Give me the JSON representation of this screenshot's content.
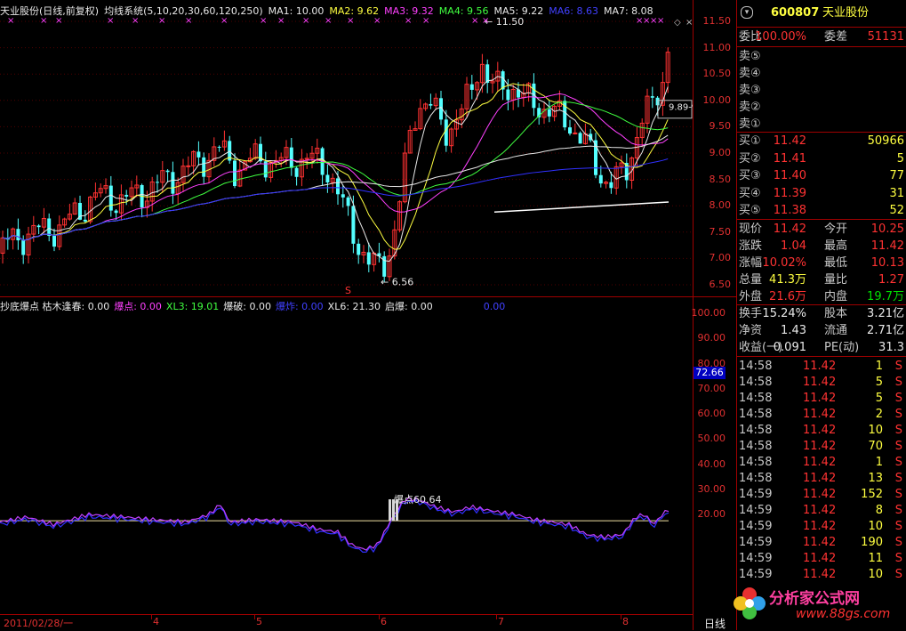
{
  "header": {
    "title": "天业股份(日线,前复权)",
    "system": "均线系统(5,10,20,30,60,120,250)",
    "mas": [
      {
        "label": "MA1: 10.00",
        "color": "#e8e8e8"
      },
      {
        "label": "MA2: 9.62",
        "color": "#ffff40"
      },
      {
        "label": "MA3: 9.32",
        "color": "#ff40ff"
      },
      {
        "label": "MA4: 9.56",
        "color": "#40ff40"
      },
      {
        "label": "MA5: 9.22",
        "color": "#e8e8e8"
      },
      {
        "label": "MA6: 8.63",
        "color": "#4040ff"
      },
      {
        "label": "MA7: 8.08",
        "color": "#e8e8e8"
      }
    ]
  },
  "price_axis": [
    "11.50",
    "11.00",
    "10.50",
    "10.00",
    "9.50",
    "9.00",
    "8.50",
    "8.00",
    "7.50",
    "7.00",
    "6.50"
  ],
  "price_marks": {
    "high": "11.50",
    "low": "6.56",
    "last": "9.89-9"
  },
  "indicator": {
    "items": [
      {
        "label": "抄底爆点 枯木逢春: 0.00",
        "color": "#e8e8e8"
      },
      {
        "label": "爆点: 0.00",
        "color": "#ff40ff"
      },
      {
        "label": "XL3: 19.01",
        "color": "#40ff40"
      },
      {
        "label": "爆破: 0.00",
        "color": "#e8e8e8"
      },
      {
        "label": "爆炸: 0.00",
        "color": "#4040ff"
      },
      {
        "label": "XL6: 21.30",
        "color": "#e8e8e8"
      },
      {
        "label": "启爆: 0.00",
        "color": "#e8e8e8"
      },
      {
        "label": "0.00",
        "color": "#4040ff"
      }
    ],
    "axis": [
      "100.00",
      "90.00",
      "80.00",
      "70.00",
      "60.00",
      "50.00",
      "40.00",
      "30.00",
      "20.00"
    ],
    "current": "72.66",
    "annotation": "爆点60.64"
  },
  "x_axis": {
    "date": "2011/02/28/一",
    "months": [
      "4",
      "5",
      "6",
      "7",
      "8"
    ],
    "period": "日线"
  },
  "quote": {
    "code": "600807",
    "name": "天业股份",
    "wb_label": "委比",
    "wb_value": "100.00%",
    "wc_label": "委差",
    "wc_value": "51131",
    "sells": [
      {
        "label": "卖⑤"
      },
      {
        "label": "卖④"
      },
      {
        "label": "卖③"
      },
      {
        "label": "卖②"
      },
      {
        "label": "卖①"
      }
    ],
    "buys": [
      {
        "label": "买①",
        "price": "11.42",
        "vol": "50966"
      },
      {
        "label": "买②",
        "price": "11.41",
        "vol": "5"
      },
      {
        "label": "买③",
        "price": "11.40",
        "vol": "77"
      },
      {
        "label": "买④",
        "price": "11.39",
        "vol": "31"
      },
      {
        "label": "买⑤",
        "price": "11.38",
        "vol": "52"
      }
    ],
    "stats": [
      {
        "l1": "现价",
        "v1": "11.42",
        "c1": "red",
        "l2": "今开",
        "v2": "10.25",
        "c2": "red"
      },
      {
        "l1": "涨跌",
        "v1": "1.04",
        "c1": "red",
        "l2": "最高",
        "v2": "11.42",
        "c2": "red"
      },
      {
        "l1": "涨幅",
        "v1": "10.02%",
        "c1": "red",
        "l2": "最低",
        "v2": "10.13",
        "c2": "red"
      },
      {
        "l1": "总量",
        "v1": "41.3万",
        "c1": "yel",
        "l2": "量比",
        "v2": "1.27",
        "c2": "red"
      },
      {
        "l1": "外盘",
        "v1": "21.6万",
        "c1": "red",
        "l2": "内盘",
        "v2": "19.7万",
        "c2": "grn"
      }
    ],
    "stats2": [
      {
        "l1": "换手",
        "v1": "15.24%",
        "c1": "wht",
        "l2": "股本",
        "v2": "3.21亿",
        "c2": "wht"
      },
      {
        "l1": "净资",
        "v1": "1.43",
        "c1": "wht",
        "l2": "流通",
        "v2": "2.71亿",
        "c2": "wht"
      },
      {
        "l1": "收益(一)",
        "v1": "0.091",
        "c1": "wht",
        "l2": "PE(动)",
        "v2": "31.3",
        "c2": "wht"
      }
    ],
    "ticks": [
      {
        "t": "14:58",
        "p": "11.42",
        "v": "1",
        "s": "S"
      },
      {
        "t": "14:58",
        "p": "11.42",
        "v": "5",
        "s": "S"
      },
      {
        "t": "14:58",
        "p": "11.42",
        "v": "5",
        "s": "S"
      },
      {
        "t": "14:58",
        "p": "11.42",
        "v": "2",
        "s": "S"
      },
      {
        "t": "14:58",
        "p": "11.42",
        "v": "10",
        "s": "S"
      },
      {
        "t": "14:58",
        "p": "11.42",
        "v": "70",
        "s": "S"
      },
      {
        "t": "14:58",
        "p": "11.42",
        "v": "1",
        "s": "S"
      },
      {
        "t": "14:58",
        "p": "11.42",
        "v": "13",
        "s": "S"
      },
      {
        "t": "14:59",
        "p": "11.42",
        "v": "152",
        "s": "S"
      },
      {
        "t": "14:59",
        "p": "11.42",
        "v": "8",
        "s": "S"
      },
      {
        "t": "14:59",
        "p": "11.42",
        "v": "10",
        "s": "S"
      },
      {
        "t": "14:59",
        "p": "11.42",
        "v": "190",
        "s": "S"
      },
      {
        "t": "14:59",
        "p": "11.42",
        "v": "11",
        "s": "S"
      },
      {
        "t": "14:59",
        "p": "11.42",
        "v": "10",
        "s": "S"
      }
    ],
    "watermark": "分析家公式网",
    "watermark_url": "www.88gs.com"
  }
}
